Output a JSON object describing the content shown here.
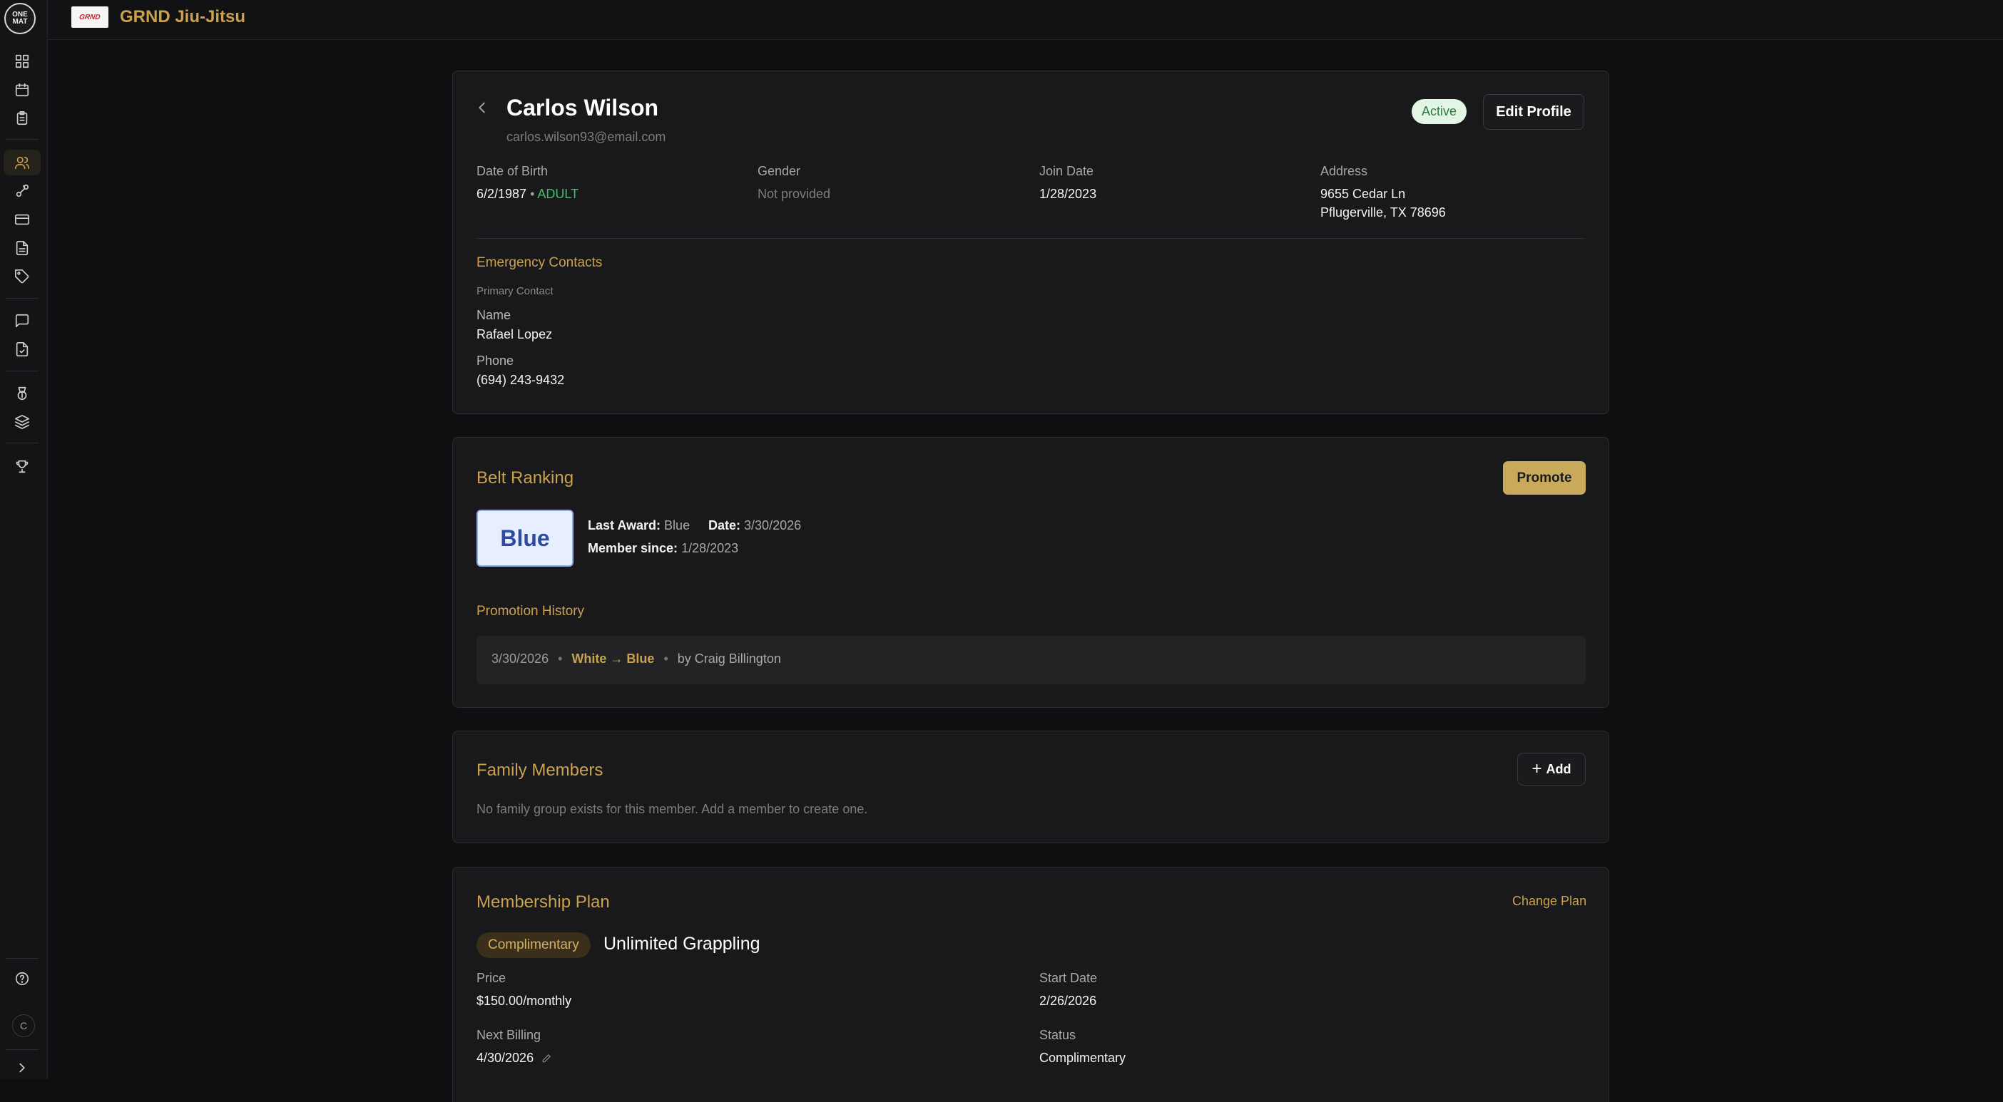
{
  "app": {
    "logo_text_top": "ONE",
    "logo_text_bottom": "MAT",
    "brand_image_text": "GRND",
    "gym_name": "GRND Jiu-Jitsu",
    "user_initial": "C"
  },
  "sidebar": {
    "items": [
      {
        "icon": "dashboard-icon"
      },
      {
        "icon": "calendar-icon"
      },
      {
        "icon": "clipboard-icon"
      },
      {
        "icon": "users-icon",
        "active": true
      },
      {
        "icon": "leads-icon"
      },
      {
        "icon": "card-icon"
      },
      {
        "icon": "document-icon"
      },
      {
        "icon": "tag-icon"
      },
      {
        "icon": "message-icon"
      },
      {
        "icon": "file-check-icon"
      },
      {
        "icon": "belt-icon"
      },
      {
        "icon": "layers-icon"
      },
      {
        "icon": "trophy-icon"
      }
    ],
    "help_icon": "help-icon",
    "expand_icon": "chevron-right-icon"
  },
  "profile": {
    "name": "Carlos Wilson",
    "email": "carlos.wilson93@email.com",
    "status": "Active",
    "edit_label": "Edit Profile",
    "dob_label": "Date of Birth",
    "dob_value": "6/2/1987",
    "dob_sep": "•",
    "age_group": "ADULT",
    "gender_label": "Gender",
    "gender_value": "Not provided",
    "join_label": "Join Date",
    "join_value": "1/28/2023",
    "address_label": "Address",
    "address_line1": "9655 Cedar Ln",
    "address_line2": "Pflugerville, TX 78696",
    "emergency_title": "Emergency Contacts",
    "primary_contact": "Primary Contact",
    "contact_name_label": "Name",
    "contact_name": "Rafael Lopez",
    "contact_phone_label": "Phone",
    "contact_phone": "(694) 243-9432"
  },
  "belt": {
    "title": "Belt Ranking",
    "promote_label": "Promote",
    "current": "Blue",
    "last_award_label": "Last Award:",
    "last_award_value": "Blue",
    "date_label": "Date:",
    "date_value": "3/30/2026",
    "member_since_label": "Member since:",
    "member_since_value": "1/28/2023",
    "history_title": "Promotion History",
    "history": [
      {
        "date": "3/30/2026",
        "sep": "•",
        "change": "White → Blue",
        "by": "by Craig Billington"
      }
    ]
  },
  "family": {
    "title": "Family Members",
    "add_label": "Add",
    "empty_text": "No family group exists for this member. Add a member to create one."
  },
  "membership": {
    "title": "Membership Plan",
    "change_label": "Change Plan",
    "type_badge": "Complimentary",
    "plan_name": "Unlimited Grappling",
    "price_label": "Price",
    "price_value": "$150.00/monthly",
    "start_label": "Start Date",
    "start_value": "2/26/2026",
    "next_billing_label": "Next Billing",
    "next_billing_value": "4/30/2026",
    "status_label": "Status",
    "status_value": "Complimentary"
  },
  "colors": {
    "accent": "#c9a24f",
    "background": "#0f0f11",
    "card": "#19191b",
    "active_badge_bg": "#e3f6e6",
    "active_badge_text": "#2c7a3f",
    "belt_blue": "#2f4ba0",
    "adult_green": "#3fbf6a"
  }
}
